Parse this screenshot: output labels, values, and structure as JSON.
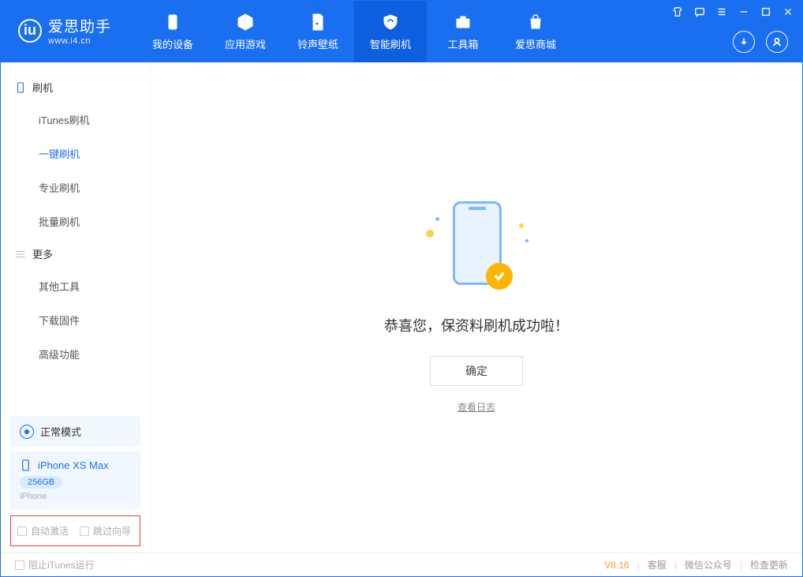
{
  "app": {
    "name_cn": "爱思助手",
    "url": "www.i4.cn"
  },
  "nav": {
    "items": [
      {
        "label": "我的设备"
      },
      {
        "label": "应用游戏"
      },
      {
        "label": "铃声壁纸"
      },
      {
        "label": "智能刷机"
      },
      {
        "label": "工具箱"
      },
      {
        "label": "爱思商城"
      }
    ]
  },
  "sidebar": {
    "section_flash": "刷机",
    "items_flash": [
      "iTunes刷机",
      "一键刷机",
      "专业刷机",
      "批量刷机"
    ],
    "section_more": "更多",
    "items_more": [
      "其他工具",
      "下载固件",
      "高级功能"
    ],
    "mode": "正常模式",
    "device": {
      "name": "iPhone XS Max",
      "storage": "256GB",
      "type": "iPhone"
    },
    "options": {
      "auto_activate": "自动激活",
      "skip_guide": "跳过向导"
    }
  },
  "main": {
    "success_title": "恭喜您，保资料刷机成功啦！",
    "ok_button": "确定",
    "view_log": "查看日志"
  },
  "footer": {
    "block_itunes": "阻止iTunes运行",
    "version": "V8.16",
    "links": [
      "客服",
      "微信公众号",
      "检查更新"
    ]
  }
}
